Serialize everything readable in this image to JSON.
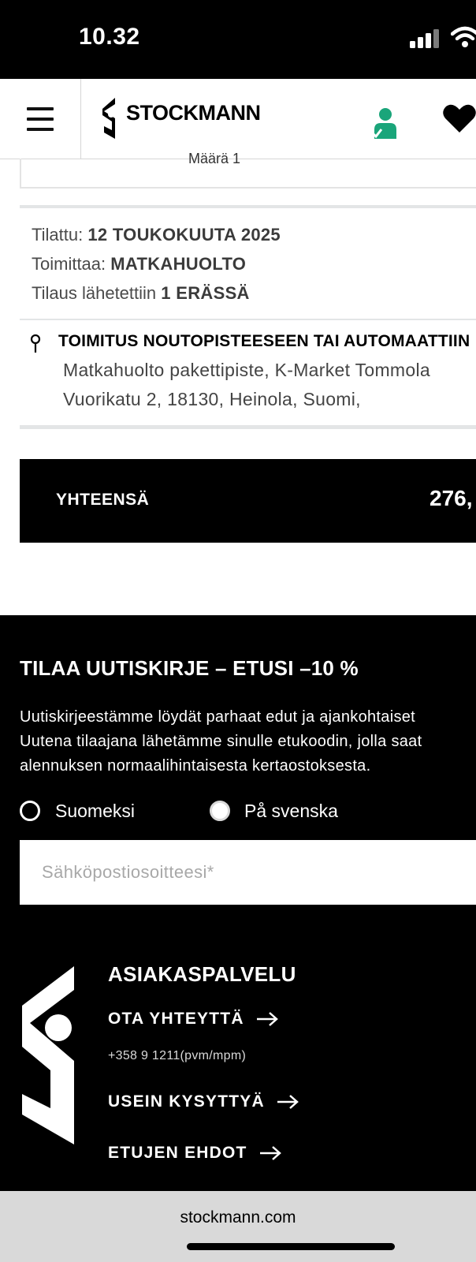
{
  "status_bar": {
    "time": "10.32"
  },
  "header": {
    "brand": "STOCKMANN"
  },
  "order": {
    "quantity_label": "Määrä 1",
    "ordered_label": "Tilattu:",
    "ordered_value": "12 TOUKOKUUTA 2025",
    "delivered_by_label": "Toimittaa:",
    "delivered_by_value": "MATKAHUOLTO",
    "shipments_label": "Tilaus lähetettiin",
    "shipments_value": "1 ERÄSSÄ",
    "delivery_title": "TOIMITUS NOUTOPISTEESEEN TAI AUTOMAATTIIN",
    "address_line1": "Matkahuolto pakettipiste, K-Market Tommola",
    "address_line2": "Vuorikatu 2, 18130, Heinola, Suomi,"
  },
  "total": {
    "label": "YHTEENSÄ",
    "amount": "276,"
  },
  "newsletter": {
    "title": "TILAA UUTISKIRJE – ETUSI –10 %",
    "text_line1": "Uutiskirjeestämme löydät parhaat edut ja ajankohtaiset",
    "text_line2": "Uutena tilaajana lähetämme sinulle etukoodin, jolla saat",
    "text_line3": "alennuksen normaalihintaisesta kertaostoksesta.",
    "option_fi": "Suomeksi",
    "option_sv": "På svenska",
    "email_placeholder": "Sähköpostiosoitteesi*"
  },
  "customer_service": {
    "title": "ASIAKASPALVELU",
    "contact_label": "OTA YHTEYTTÄ",
    "phone": "+358 9 1211(pvm/mpm)",
    "faq_label": "USEIN KYSYTTYÄ",
    "terms_label": "ETUJEN EHDOT"
  },
  "browser": {
    "url": "stockmann.com"
  },
  "colors": {
    "account_green": "#1aa57a",
    "footer_bg": "#000000"
  }
}
